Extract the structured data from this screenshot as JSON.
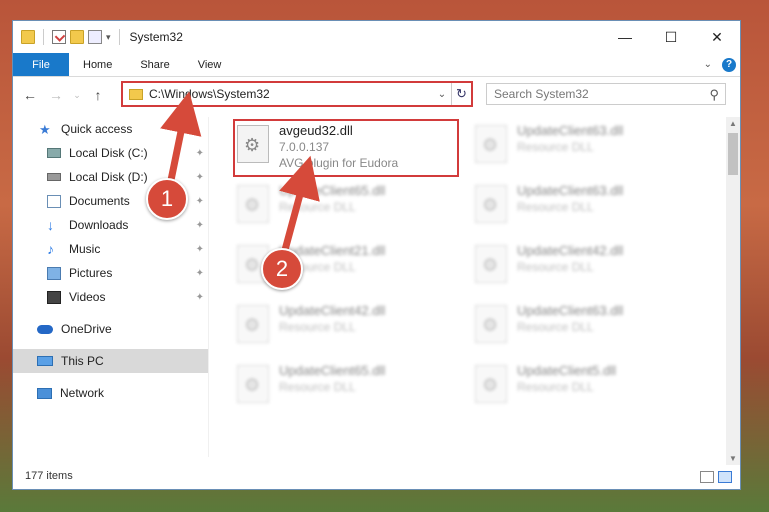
{
  "window": {
    "title": "System32",
    "controls": {
      "minimize": "—",
      "maximize": "☐",
      "close": "✕"
    }
  },
  "ribbon": {
    "tabs": [
      "File",
      "Home",
      "Share",
      "View"
    ],
    "help_glyph": "?"
  },
  "nav": {
    "back": "←",
    "forward": "→",
    "up": "↑",
    "address": "C:\\Windows\\System32",
    "dropdown": "⌄",
    "refresh": "↻",
    "search_placeholder": "Search System32",
    "search_glyph": "⚲"
  },
  "sidebar": {
    "items": [
      {
        "label": "Quick access",
        "icon": "star-icon",
        "pinned": false
      },
      {
        "label": "Local Disk (C:)",
        "icon": "drive-icon",
        "pinned": true
      },
      {
        "label": "Local Disk (D:)",
        "icon": "drive-icon",
        "pinned": true
      },
      {
        "label": "Documents",
        "icon": "documents-icon",
        "pinned": true
      },
      {
        "label": "Downloads",
        "icon": "download-icon",
        "pinned": true
      },
      {
        "label": "Music",
        "icon": "music-icon",
        "pinned": true
      },
      {
        "label": "Pictures",
        "icon": "pictures-icon",
        "pinned": true
      },
      {
        "label": "Videos",
        "icon": "videos-icon",
        "pinned": true
      },
      {
        "label": "OneDrive",
        "icon": "cloud-icon",
        "pinned": false
      },
      {
        "label": "This PC",
        "icon": "computer-icon",
        "pinned": false,
        "selected": true
      },
      {
        "label": "Network",
        "icon": "network-icon",
        "pinned": false
      }
    ],
    "pin_glyph": "📌"
  },
  "files": {
    "highlighted": {
      "name": "avgeud32.dll",
      "version": "7.0.0.137",
      "description": "AVG plugin for Eudora"
    },
    "others": [
      {
        "name": "UpdateClient63.dll",
        "sub": "Resource DLL"
      },
      {
        "name": "UpdateClient65.dll",
        "sub": "Resource DLL"
      },
      {
        "name": "UpdateClient63.dll",
        "sub": "Resource DLL"
      },
      {
        "name": "UpdateClient21.dll",
        "sub": "Resource DLL"
      },
      {
        "name": "UpdateClient42.dll",
        "sub": "Resource DLL"
      },
      {
        "name": "UpdateClient42.dll",
        "sub": "Resource DLL"
      },
      {
        "name": "UpdateClient63.dll",
        "sub": "Resource DLL"
      },
      {
        "name": "UpdateClient65.dll",
        "sub": "Resource DLL"
      },
      {
        "name": "UpdateClient5.dll",
        "sub": "Resource DLL"
      }
    ]
  },
  "status": {
    "count": "177 items"
  },
  "annotations": {
    "step1": "1",
    "step2": "2"
  },
  "colors": {
    "accent": "#1979ca",
    "highlight": "#d23b3b",
    "badge": "#d64a3a"
  }
}
